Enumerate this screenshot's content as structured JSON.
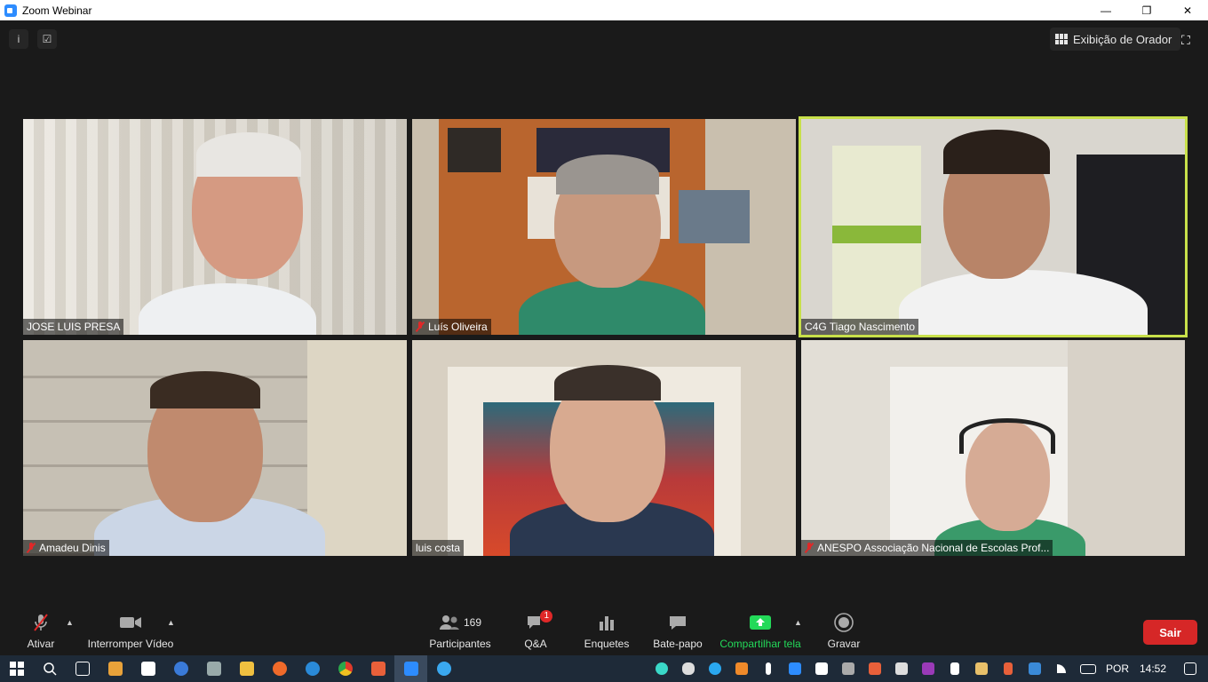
{
  "window": {
    "title": "Zoom Webinar"
  },
  "top_bar": {
    "view_label": "Exibição de Orador"
  },
  "participants": [
    {
      "name": "JOSE LUIS PRESA",
      "muted": false
    },
    {
      "name": "Luís Oliveira",
      "muted": true
    },
    {
      "name": "C4G Tiago Nascimento",
      "muted": false,
      "active_speaker": true
    },
    {
      "name": "Amadeu Dinis",
      "muted": true
    },
    {
      "name": "luis costa",
      "muted": false
    },
    {
      "name": "ANESPO Associação Nacional de Escolas Prof...",
      "muted": true
    }
  ],
  "toolbar": {
    "mute_label": "Ativar",
    "video_label": "Interromper Vídeo",
    "participants_label": "Participantes",
    "participants_count": "169",
    "qa_label": "Q&A",
    "qa_badge": "1",
    "polls_label": "Enquetes",
    "chat_label": "Bate-papo",
    "share_label": "Compartilhar tela",
    "record_label": "Gravar",
    "leave_label": "Sair"
  },
  "taskbar": {
    "language": "POR",
    "time": "14:52"
  },
  "colors": {
    "active_outline": "#c8e04a",
    "share_green": "#23d959",
    "leave_red": "#d62727"
  }
}
